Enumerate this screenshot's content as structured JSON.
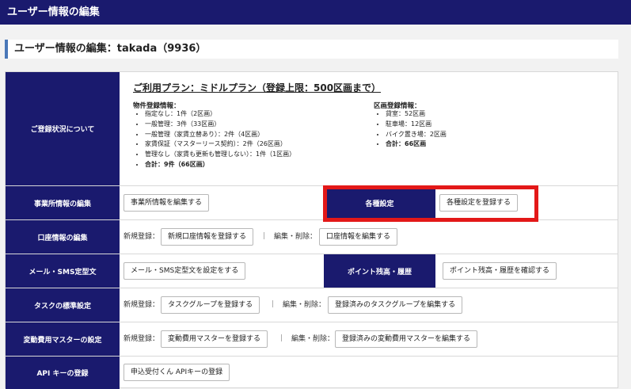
{
  "topbar": {
    "title": "ユーザー情報の編集"
  },
  "heading": {
    "title": "ユーザー情報の編集：takada（9936）"
  },
  "status": {
    "label": "ご登録状況について",
    "plan": "ご利用プラン：ミドルプラン（登録上限：500区画まで）",
    "property_heading": "物件登録情報：",
    "property_items": [
      "指定なし：1件（2区画）",
      "一般管理：3件（33区画）",
      "一般管理（家賃立替あり）：2件（4区画）",
      "家賃保証（マスターリース契約）：2件（26区画）",
      "管理なし（家賃も更新も管理しない）：1件（1区画）"
    ],
    "property_total": "合計：9件（66区画）",
    "section_heading": "区画登録情報：",
    "section_items": [
      "貸室：52区画",
      "駐車場：12区画",
      "バイク置き場：2区画"
    ],
    "section_total": "合計：66区画"
  },
  "office": {
    "label": "事業所情報の編集",
    "button": "事業所情報を編集する",
    "settings_label": "各種設定",
    "settings_button": "各種設定を登録する"
  },
  "account": {
    "label": "口座情報の編集",
    "new_text": "新規登録：",
    "new_button": "新規口座情報を登録する",
    "separator": "｜",
    "edit_text": "編集・削除：",
    "edit_button": "口座情報を編集する"
  },
  "mail": {
    "label": "メール・SMS定型文",
    "button": "メール・SMS定型文を設定をする",
    "points_label": "ポイント残高・履歴",
    "points_button": "ポイント残高・履歴を確認する"
  },
  "task": {
    "label": "タスクの標準設定",
    "new_text": "新規登録：",
    "new_button": "タスクグループを登録する",
    "separator": "｜",
    "edit_text": "編集・削除：",
    "edit_button": "登録済みのタスクグループを編集する"
  },
  "cost": {
    "label": "変動費用マスターの設定",
    "new_text": "新規登録：",
    "new_button": "変動費用マスターを登録する",
    "separator": "｜",
    "edit_text": "編集・削除：",
    "edit_button": "登録済みの変動費用マスターを編集する"
  },
  "api": {
    "label": "API キーの登録",
    "button": "申込受付くん APIキーの登録"
  },
  "colors": {
    "navy": "#1a1a6e",
    "accent": "#4a78b8",
    "highlight": "#e31818"
  }
}
